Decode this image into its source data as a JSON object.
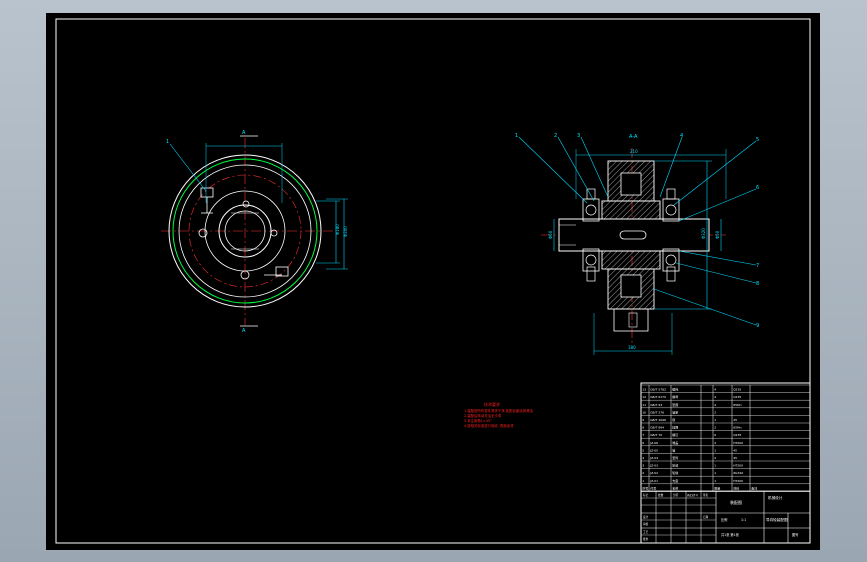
{
  "colors": {
    "background": "#000000",
    "border": "#ffffff",
    "part": "#ffffff",
    "centerline": "#ff3030",
    "dimension": "#00d8ff",
    "hidden": "#00ff40",
    "hatch": "#ffffff",
    "note": "#ff2020",
    "part_shape": "#ffffff",
    "table": "#ffffff"
  },
  "views": {
    "front": {
      "label": "A",
      "label_bottom": "A",
      "callout": "1"
    },
    "section": {
      "label": "A-A"
    }
  },
  "dimensions": {
    "front_height": "Φ300",
    "front_right": "Φ180",
    "section_bore": "Φ50",
    "section_left": "Φ60",
    "section_right": "Φ320",
    "section_bottom": "180",
    "section_top": "210"
  },
  "callouts": [
    "1",
    "2",
    "3",
    "4",
    "5",
    "6",
    "7",
    "8",
    "9"
  ],
  "technical_notes": {
    "title": "技术要求",
    "lines": [
      "1.装配前所有零件清洗干净,各配合面涂润滑油",
      "2.装配后转动灵活无卡滞",
      "3.未注倒角1×45°",
      "4.按相关标准进行验收, 表面涂漆"
    ]
  },
  "bom": {
    "rows": [
      {
        "no": "13",
        "code": "GB/T 5782",
        "name": "螺栓",
        "qty": "4",
        "material": "Q235",
        "note": ""
      },
      {
        "no": "12",
        "code": "GB/T 6170",
        "name": "螺母",
        "qty": "4",
        "material": "Q235",
        "note": ""
      },
      {
        "no": "11",
        "code": "GB/T 93",
        "name": "垫圈",
        "qty": "4",
        "material": "65Mn",
        "note": ""
      },
      {
        "no": "10",
        "code": "GB/T 276",
        "name": "轴承",
        "qty": "2",
        "material": "",
        "note": ""
      },
      {
        "no": "9",
        "code": "GB/T 1096",
        "name": "键",
        "qty": "1",
        "material": "45",
        "note": ""
      },
      {
        "no": "8",
        "code": "GB/T 894",
        "name": "挡圈",
        "qty": "2",
        "material": "65Mn",
        "note": ""
      },
      {
        "no": "7",
        "code": "GB/T 70",
        "name": "螺钉",
        "qty": "6",
        "material": "Q235",
        "note": ""
      },
      {
        "no": "6",
        "code": "JZ-06",
        "name": "端盖",
        "qty": "2",
        "material": "HT200",
        "note": ""
      },
      {
        "no": "5",
        "code": "JZ-05",
        "name": "轴",
        "qty": "1",
        "material": "45",
        "note": ""
      },
      {
        "no": "4",
        "code": "JZ-04",
        "name": "套筒",
        "qty": "2",
        "material": "45",
        "note": ""
      },
      {
        "no": "3",
        "code": "JZ-03",
        "name": "轮毂",
        "qty": "1",
        "material": "HT200",
        "note": ""
      },
      {
        "no": "2",
        "code": "JZ-02",
        "name": "轮缘",
        "qty": "1",
        "material": "ZG310",
        "note": ""
      },
      {
        "no": "1",
        "code": "JZ-01",
        "name": "支座",
        "qty": "1",
        "material": "HT200",
        "note": ""
      }
    ],
    "header": {
      "no": "序号",
      "code": "代号",
      "name": "名称",
      "qty": "数量",
      "material": "材料",
      "note": "备注"
    }
  },
  "title_block": {
    "drawing_title": "装配图",
    "project": "导向轮装配图",
    "scale_label": "比例",
    "scale_value": "1:1",
    "sheet": "共1张 第1张",
    "school": "机械设计",
    "drawing_no": "图号",
    "labels": [
      "设计",
      "审核",
      "工艺",
      "批准",
      "标记",
      "处数",
      "分区",
      "更改文件号",
      "签名",
      "日期"
    ]
  }
}
